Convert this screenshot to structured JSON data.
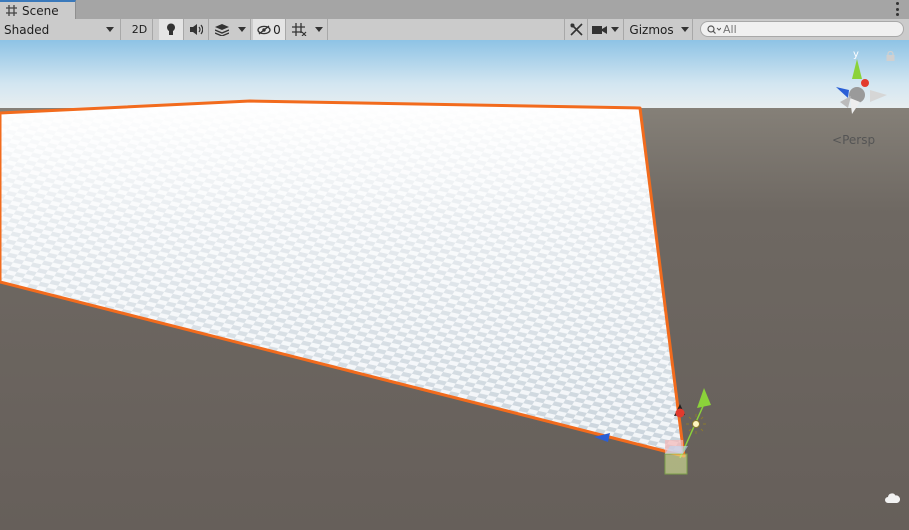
{
  "window": {
    "tab_title": "Scene",
    "tab_icon": "grid-icon"
  },
  "toolbar": {
    "draw_mode": "Shaded",
    "mode_2d_label": "2D",
    "lighting_icon": "lightbulb-icon",
    "audio_icon": "speaker-icon",
    "effects_icon": "layers-icon",
    "hidden_count": "0",
    "grid_icon": "grid-snap-icon",
    "tools_icon": "tools-icon",
    "camera_icon": "camera-icon",
    "gizmos_label": "Gizmos",
    "search_placeholder": "All"
  },
  "scene": {
    "projection_label": "Persp",
    "orientation_gizmo_axis_label": "y",
    "selection_outline_color": "#f26b1d",
    "sky_color": "#8fc4e6",
    "ground_color": "#6b6560"
  }
}
